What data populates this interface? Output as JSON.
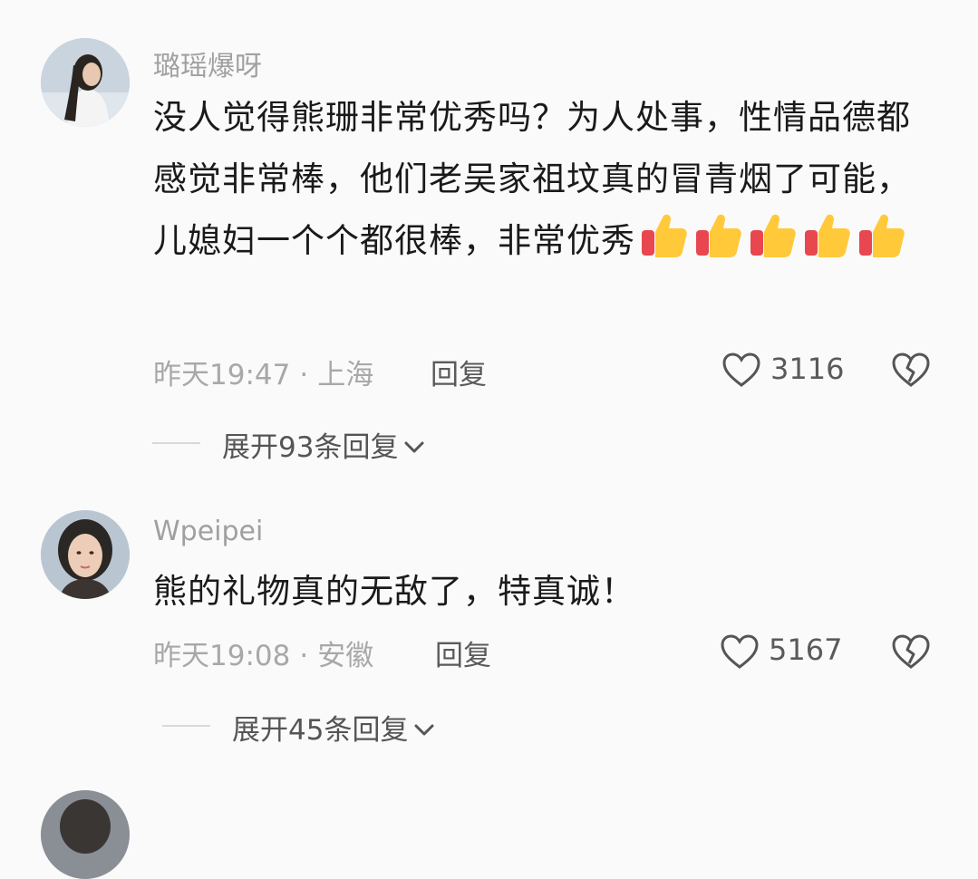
{
  "comments": [
    {
      "username": "璐瑶爆呀",
      "text": "没人觉得熊珊非常优秀吗？为人处事，性情品德都感觉非常棒，他们老吴家祖坟真的冒青烟了可能，儿媳妇一个个都很棒，非常优秀",
      "thumbs_emoji": 5,
      "time": "昨天19:47",
      "separator": "·",
      "location": "上海",
      "reply_label": "回复",
      "likes": "3116",
      "expand_label": "展开93条回复"
    },
    {
      "username": "Wpeipei",
      "text": "熊的礼物真的无敌了，特真诚！",
      "time": "昨天19:08",
      "separator": "·",
      "location": "安徽",
      "reply_label": "回复",
      "likes": "5167",
      "expand_label": "展开45条回复"
    }
  ],
  "icons": {
    "like": "heart-outline-icon",
    "dislike": "broken-heart-icon",
    "expand": "chevron-down-icon",
    "emoji": "thumbs-up-emoji"
  },
  "colors": {
    "background": "#fafafa",
    "username": "#a0a0a0",
    "text": "#1a1a1a",
    "meta": "#a8a8a8"
  }
}
